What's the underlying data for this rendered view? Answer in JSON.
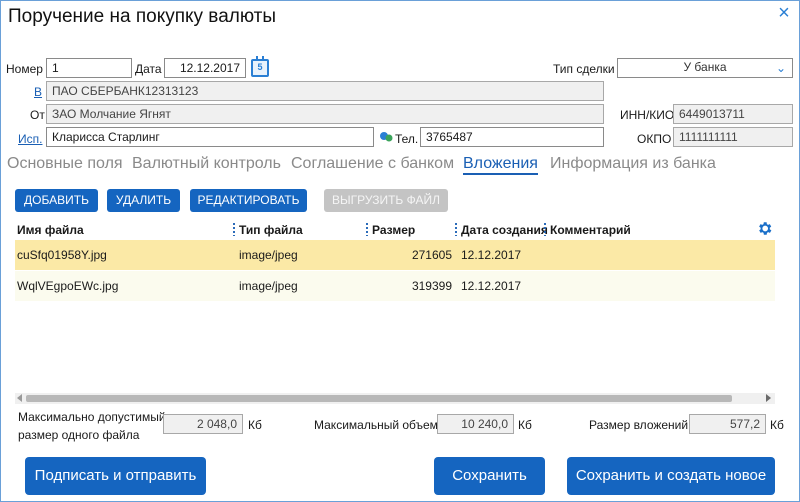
{
  "window": {
    "title": "Поручение на покупку валюты",
    "close_icon": "×"
  },
  "form": {
    "number_label": "Номер",
    "number_value": "1",
    "date_label": "Дата",
    "date_value": "12.12.2017",
    "calendar_day": "5",
    "deal_type_label": "Тип сделки",
    "deal_type_value": "У банка",
    "bank_link": "В",
    "bank_value": "ПАО СБЕРБАНК12313123",
    "from_label": "От",
    "from_value": "ЗАО Молчание Ягнят",
    "inn_label": "ИНН/КИО",
    "inn_value": "6449013711",
    "executor_link": "Исп.",
    "executor_value": "Кларисса Старлинг",
    "phone_label": "Тел.",
    "phone_value": "3765487",
    "okpo_label": "ОКПО",
    "okpo_value": "1111111111"
  },
  "tabs": [
    {
      "label": "Основные поля",
      "active": false
    },
    {
      "label": "Валютный контроль",
      "active": false
    },
    {
      "label": "Соглашение с банком",
      "active": false
    },
    {
      "label": "Вложения",
      "active": true
    },
    {
      "label": "Информация из банка",
      "active": false
    }
  ],
  "toolbar": {
    "add": "ДОБАВИТЬ",
    "delete": "УДАЛИТЬ",
    "edit": "РЕДАКТИРОВАТЬ",
    "export": "ВЫГРУЗИТЬ ФАЙЛ"
  },
  "table": {
    "columns": [
      "Имя файла",
      "Тип файла",
      "Размер",
      "Дата создания",
      "Комментарий"
    ],
    "rows": [
      {
        "name": "cuSfq01958Y.jpg",
        "type": "image/jpeg",
        "size": "271605",
        "date": "12.12.2017",
        "comment": "",
        "selected": true
      },
      {
        "name": "WqlVEgpoEWc.jpg",
        "type": "image/jpeg",
        "size": "319399",
        "date": "12.12.2017",
        "comment": "",
        "selected": false
      }
    ]
  },
  "limits": {
    "max_file_label_1": "Максимально допустимый",
    "max_file_label_2": "размер одного файла",
    "max_file_value": "2 048,0",
    "max_volume_label": "Максимальный объем",
    "max_volume_value": "10 240,0",
    "attach_size_label": "Размер вложений",
    "attach_size_value": "577,2",
    "unit": "Кб"
  },
  "actions": {
    "sign_send": "Подписать и отправить",
    "save": "Сохранить",
    "save_new": "Сохранить и создать новое"
  },
  "colors": {
    "accent": "#1565c0",
    "link": "#1a5fb4",
    "selected_row": "#fbe9a6",
    "alt_row": "#fbfbee"
  }
}
